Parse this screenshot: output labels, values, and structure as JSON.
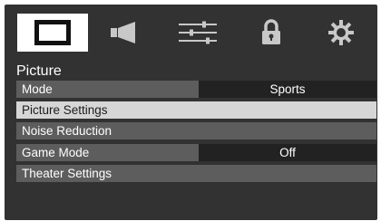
{
  "tabs": [
    {
      "icon": "picture-icon",
      "active": true
    },
    {
      "icon": "speaker-icon",
      "active": false
    },
    {
      "icon": "sliders-icon",
      "active": false
    },
    {
      "icon": "lock-icon",
      "active": false
    },
    {
      "icon": "gear-icon",
      "active": false
    }
  ],
  "section": {
    "title": "Picture"
  },
  "menu": {
    "items": [
      {
        "label": "Mode",
        "value": "Sports",
        "selected": false
      },
      {
        "label": "Picture Settings",
        "selected": true
      },
      {
        "label": "Noise Reduction",
        "selected": false
      },
      {
        "label": "Game Mode",
        "value": "Off",
        "selected": false
      },
      {
        "label": "Theater Settings",
        "selected": false
      }
    ]
  },
  "colors": {
    "background": "#323232",
    "row": "#5d5d5d",
    "row_selected": "#d6d6d6",
    "value_box": "#222222",
    "active_tab": "#ffffff"
  }
}
